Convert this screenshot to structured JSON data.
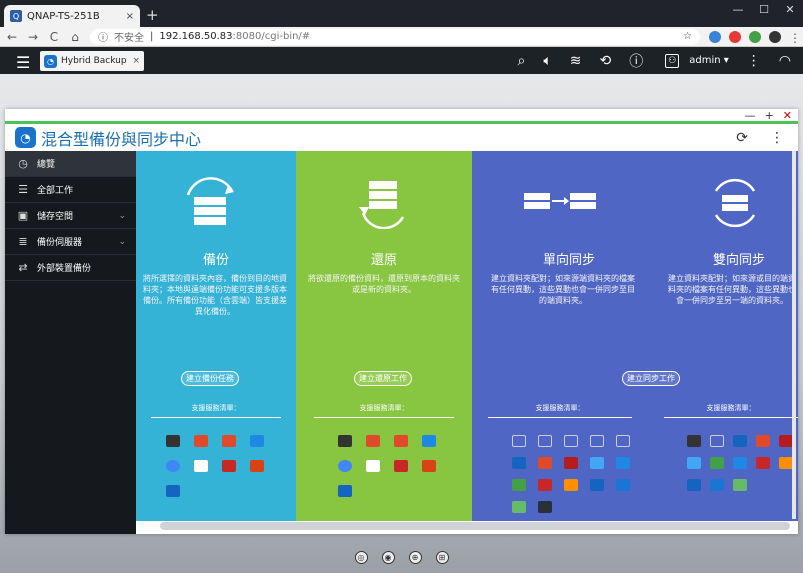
{
  "browser": {
    "tab_title": "QNAP-TS-251B",
    "tab_close": "×",
    "new_tab": "+",
    "win_min": "—",
    "win_max": "☐",
    "win_close": "✕",
    "back": "←",
    "forward": "→",
    "reload": "C",
    "home": "⌂",
    "insecure_label": "不安全",
    "url_host": "192.168.50.83",
    "url_rest": ":8080/cgi-bin/#"
  },
  "qts": {
    "menu": "☰",
    "app_tab_title": "Hybrid Backup Sync...",
    "app_tab_close": "×",
    "username": "admin ▾",
    "icons": [
      "search-icon",
      "volume-icon",
      "tasks-icon",
      "sync-icon",
      "info-icon",
      "user-icon",
      "dashboard-icon"
    ]
  },
  "app": {
    "window_controls": {
      "min": "—",
      "max": "+",
      "close": "✕"
    },
    "title": "混合型備份與同步中心",
    "logo": "◔",
    "refresh": "⟳",
    "more": "⋮"
  },
  "sidebar": {
    "items": [
      {
        "label": "總覽",
        "icon": "◷",
        "active": true,
        "chev": ""
      },
      {
        "label": "全部工作",
        "icon": "☰",
        "active": false,
        "chev": ""
      },
      {
        "label": "儲存空間",
        "icon": "▣",
        "active": false,
        "chev": "⌄"
      },
      {
        "label": "備份伺服器",
        "icon": "≣",
        "active": false,
        "chev": "⌄"
      },
      {
        "label": "外部裝置備份",
        "icon": "⇄",
        "active": false,
        "chev": ""
      }
    ]
  },
  "panels": [
    {
      "title": "備份",
      "desc": "將所選擇的資料夾內容，備份到目的地資料夾；本地與遠端備份功能可支援多版本備份。所有備份功能（含雲端）皆支援差異化備份。",
      "button": "建立備份任務",
      "supported": "支援服務清單："
    },
    {
      "title": "還原",
      "desc": "將欲還原的備份資料，還原到原本的資料夾或是新的資料夾。",
      "button": "建立還原工作",
      "supported": "支援服務清單："
    },
    {
      "title": "單向同步",
      "desc": "建立資料夾配對；如來源端資料夾的檔案有任何異動，這些異動也會一併同步至目的端資料夾。",
      "button": "建立同步工作",
      "supported": "支援服務清單："
    },
    {
      "title": "雙向同步",
      "desc": "建立資料夾配對；如來源或目的端資料夾的檔案有任何異動，這些異動也會一併同步至另一端的資料夾。",
      "button": "",
      "supported": "支援服務清單："
    }
  ],
  "colors": {
    "backup": "#35b3d6",
    "restore": "#88c540",
    "sync": "#4f66c4",
    "accent_line": "#4ec25a",
    "title": "#1a6fb0"
  },
  "dock": {
    "icons": [
      "◎",
      "◉",
      "⊕",
      "⊞"
    ]
  }
}
